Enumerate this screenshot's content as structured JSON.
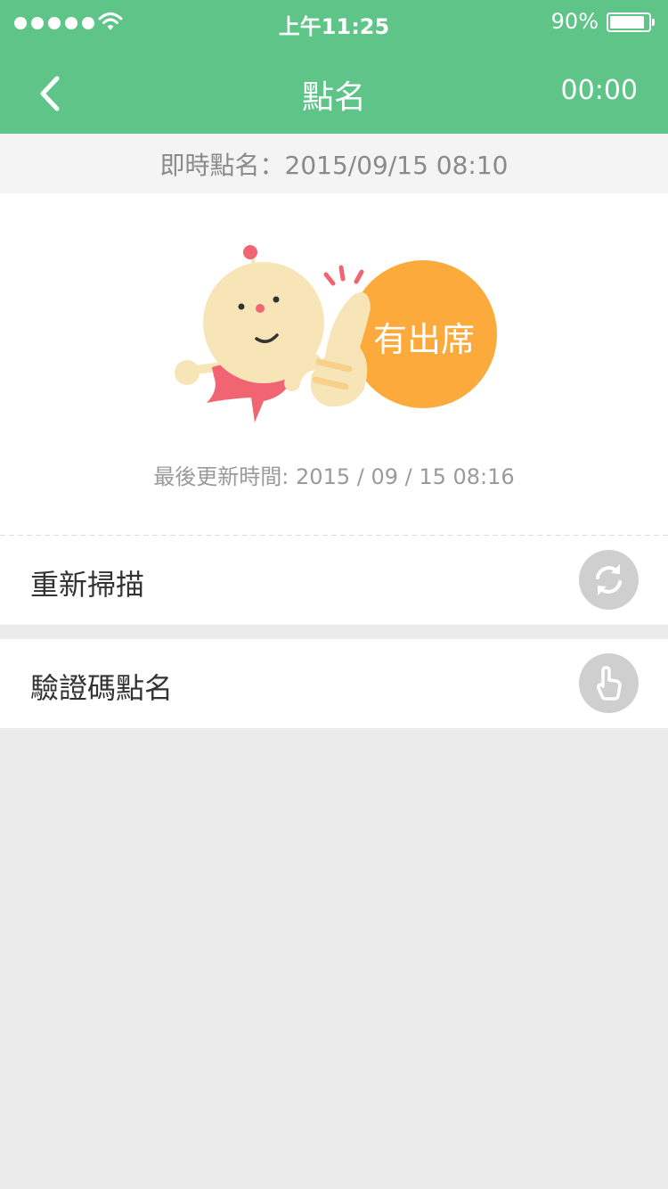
{
  "status_bar": {
    "time": "上午11:25",
    "battery_percent": "90%",
    "battery_level": 0.9
  },
  "nav": {
    "title": "點名",
    "back_icon": "chevron-left-icon",
    "timer": "00:00"
  },
  "realtime": {
    "text": "即時點名：2015/09/15 08:10"
  },
  "attendance": {
    "status": "有出席",
    "last_update": "最後更新時間: 2015 / 09 / 15 08:16"
  },
  "actions": [
    {
      "label": "重新掃描",
      "icon": "refresh-icon"
    },
    {
      "label": "驗證碼點名",
      "icon": "tap-hand-icon"
    }
  ],
  "colors": {
    "header": "#5ec487",
    "badge": "#fcaa3c",
    "icon_circle": "#cfcfcf",
    "background": "#ebebeb"
  }
}
